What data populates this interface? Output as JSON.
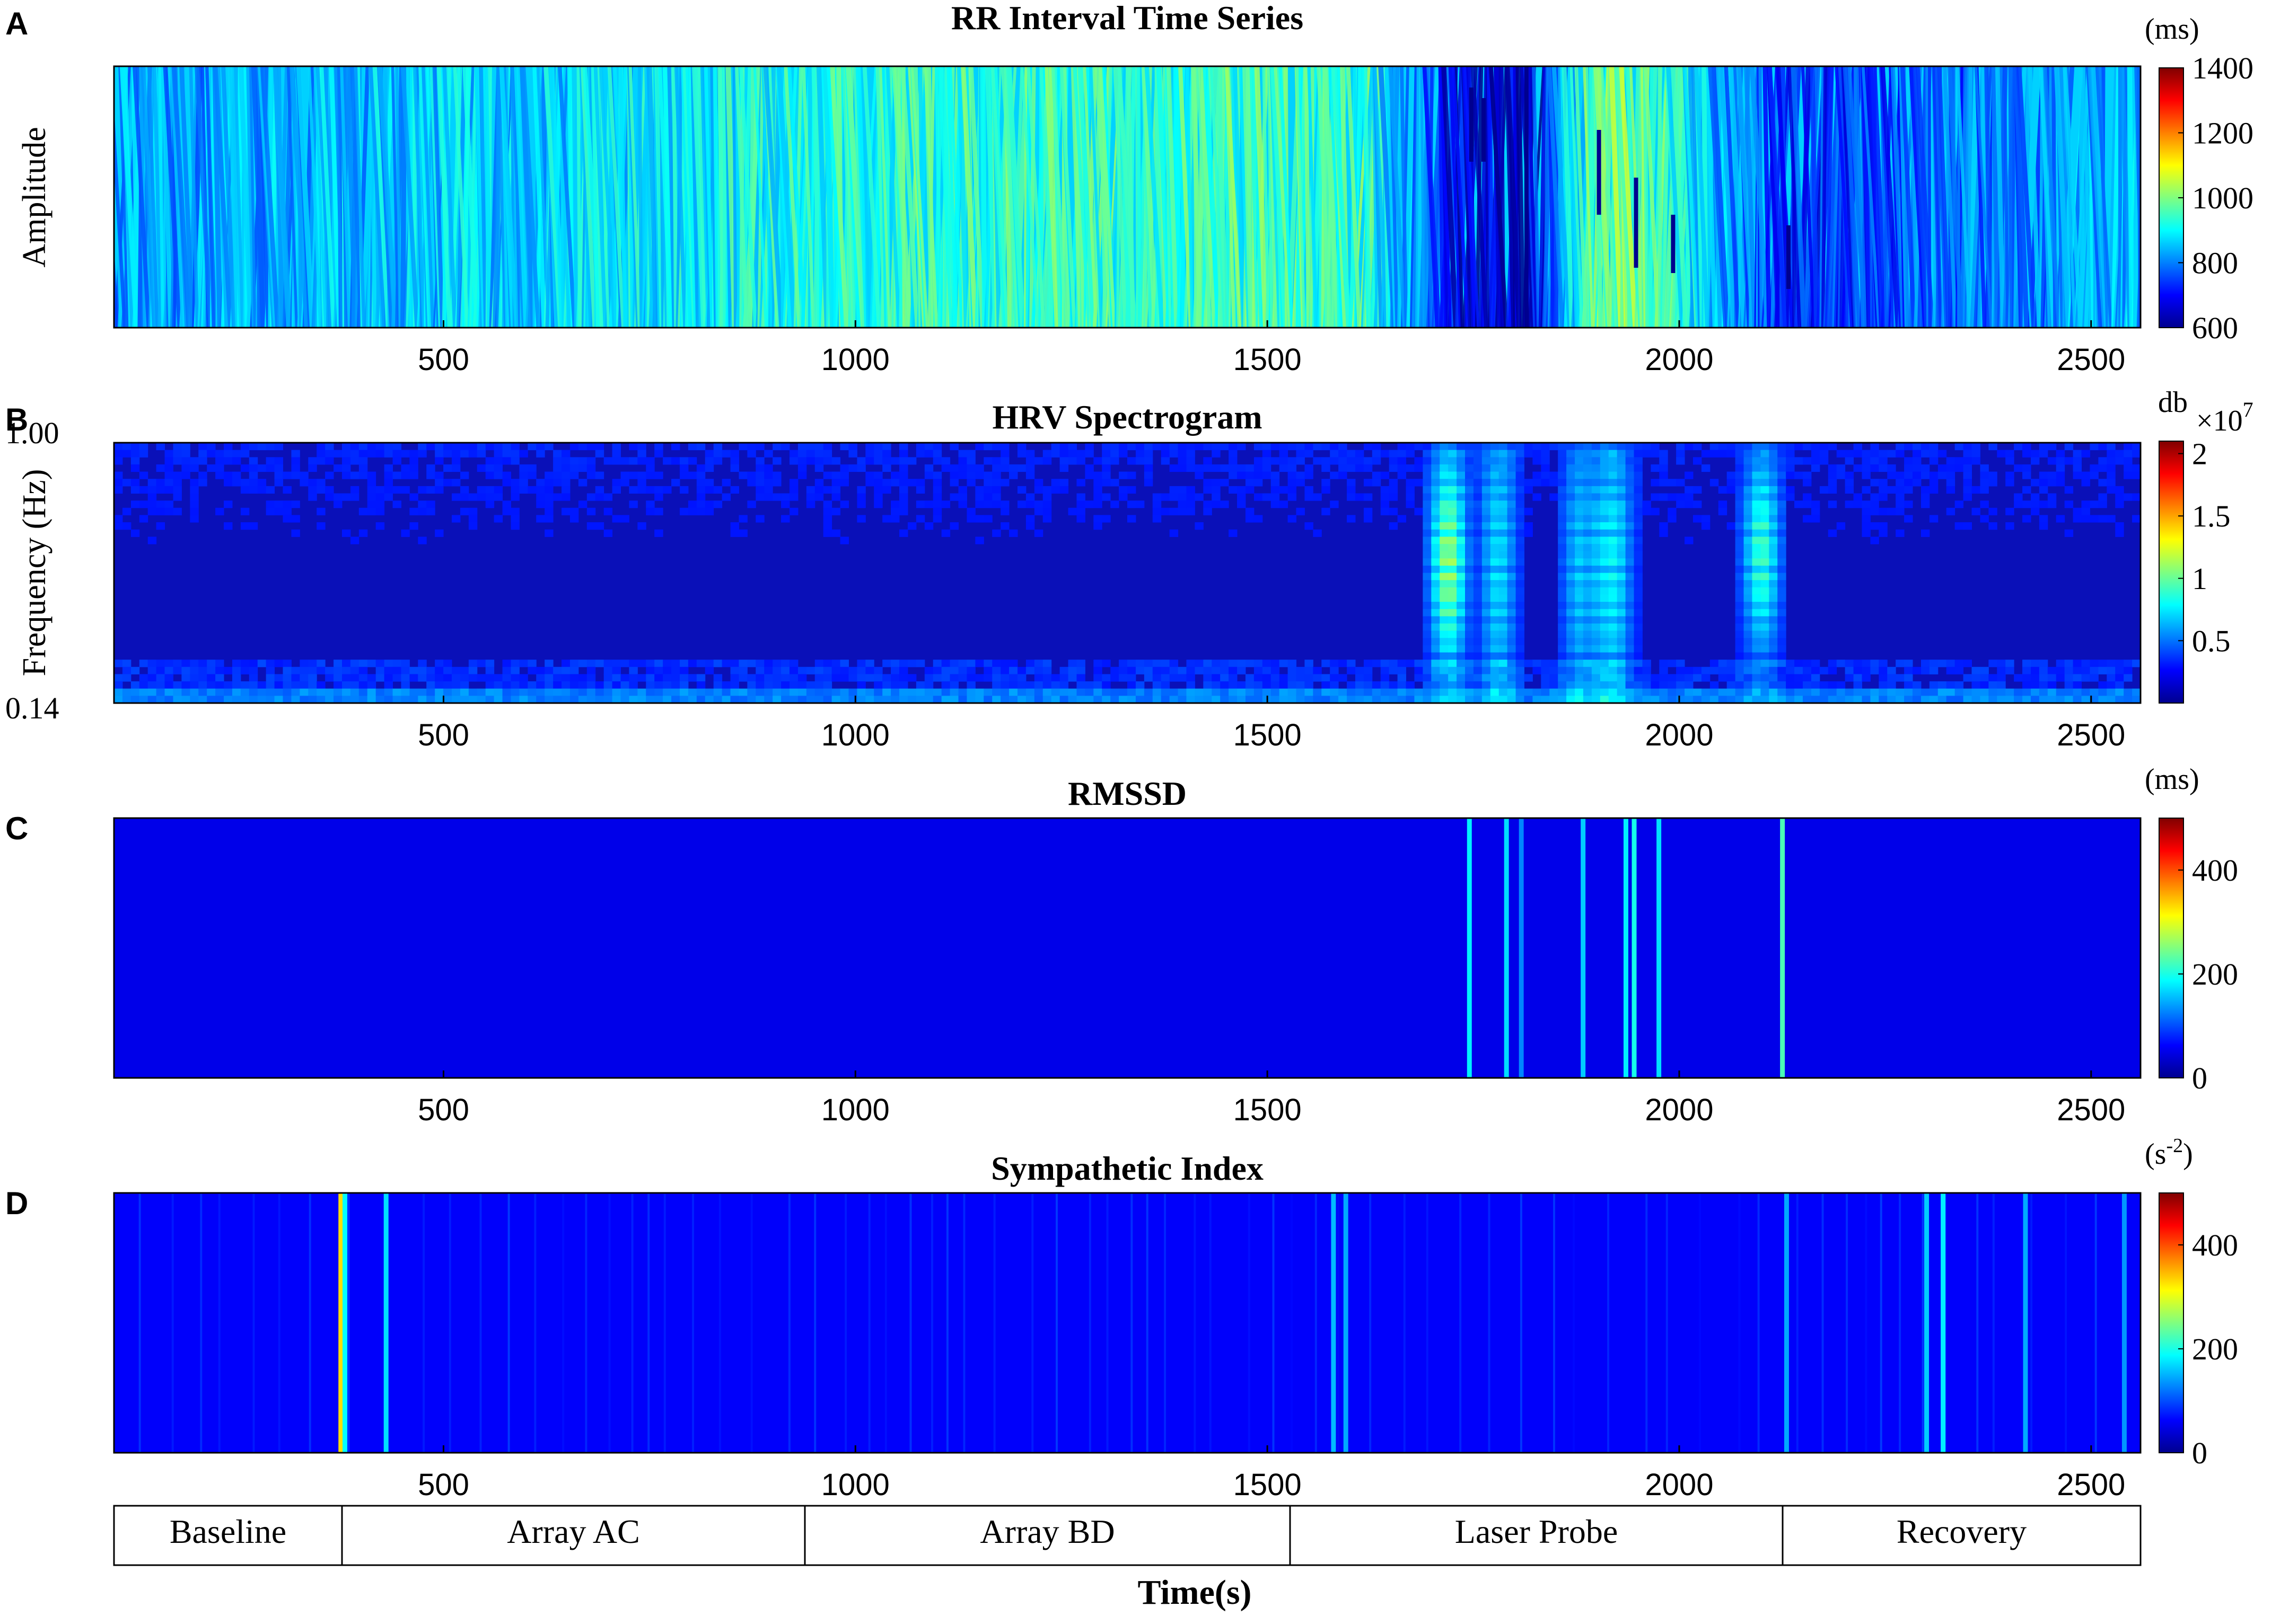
{
  "panels": [
    {
      "letter": "A",
      "title": "RR Interval Time Series",
      "ylabel": "Amplitude",
      "y_top": "",
      "y_bottom": "",
      "cbar_unit": "(ms)",
      "cbar_exp": "",
      "cbar_ticks": [
        "600",
        "800",
        "1000",
        "1200",
        "1400"
      ],
      "cbar_range": [
        600,
        1400
      ]
    },
    {
      "letter": "B",
      "title": "HRV Spectrogram",
      "ylabel": "Frequency (Hz)",
      "y_top": "1.00",
      "y_bottom": "0.14",
      "cbar_unit": "db",
      "cbar_exp": "×10",
      "cbar_exp_power": "7",
      "cbar_ticks": [
        "0.5",
        "1",
        "1.5",
        "2"
      ],
      "cbar_range": [
        0,
        2.1
      ]
    },
    {
      "letter": "C",
      "title": "RMSSD",
      "ylabel": "",
      "y_top": "",
      "y_bottom": "",
      "cbar_unit": "(ms)",
      "cbar_exp": "",
      "cbar_ticks": [
        "0",
        "200",
        "400"
      ],
      "cbar_range": [
        0,
        500
      ]
    },
    {
      "letter": "D",
      "title": "Sympathetic Index",
      "ylabel": "",
      "y_top": "",
      "y_bottom": "",
      "cbar_unit": "(s",
      "cbar_unit_sup": "-2",
      "cbar_unit_close": ")",
      "cbar_exp": "",
      "cbar_ticks": [
        "0",
        "200",
        "400"
      ],
      "cbar_range": [
        0,
        500
      ]
    }
  ],
  "x_ticks": [
    "500",
    "1000",
    "1500",
    "2000",
    "2500"
  ],
  "phases": [
    "Baseline",
    "Array AC",
    "Array BD",
    "Laser Probe",
    "Recovery"
  ],
  "xlabel": "Time(s)",
  "chart_data": [
    {
      "type": "heatmap",
      "title": "RR Interval Time Series",
      "ylabel": "Amplitude",
      "xlim": [
        100,
        2560
      ],
      "colorbar_label": "(ms)",
      "colorbar_range": [
        600,
        1400
      ],
      "colormap": "jet",
      "description_values": {
        "x": [
          100,
          370,
          670,
          1050,
          1610,
          1740,
          1810,
          1900,
          1950,
          2130,
          2560
        ],
        "rr_ms": [
          830,
          860,
          900,
          980,
          1000,
          620,
          600,
          1040,
          1060,
          700,
          860
        ]
      }
    },
    {
      "type": "heatmap",
      "title": "HRV Spectrogram",
      "ylabel": "Frequency (Hz)",
      "ylim": [
        0.14,
        1.0
      ],
      "xlim": [
        100,
        2560
      ],
      "colorbar_label": "db ×10^7",
      "colorbar_range": [
        0,
        2.1
      ],
      "colormap": "jet",
      "hotspots": [
        {
          "x": 1720,
          "f_range": [
            0.3,
            0.9
          ],
          "value": 0.9
        },
        {
          "x": 1780,
          "f_range": [
            0.14,
            1.0
          ],
          "value": 0.5
        },
        {
          "x": 1880,
          "f_range": [
            0.14,
            1.0
          ],
          "value": 0.45
        },
        {
          "x": 1920,
          "f_range": [
            0.14,
            1.0
          ],
          "value": 0.55
        },
        {
          "x": 2100,
          "f_range": [
            0.35,
            0.9
          ],
          "value": 0.7
        }
      ],
      "baseline_band": {
        "f": 0.16,
        "value": 0.4
      }
    },
    {
      "type": "heatmap",
      "title": "RMSSD",
      "xlim": [
        100,
        2560
      ],
      "colorbar_label": "(ms)",
      "colorbar_range": [
        0,
        500
      ],
      "colormap": "jet",
      "lines": [
        {
          "x": 1745,
          "value": 150
        },
        {
          "x": 1790,
          "value": 140
        },
        {
          "x": 1808,
          "value": 90
        },
        {
          "x": 1883,
          "value": 130
        },
        {
          "x": 1935,
          "value": 150
        },
        {
          "x": 1945,
          "value": 170
        },
        {
          "x": 1975,
          "value": 140
        },
        {
          "x": 2125,
          "value": 200
        }
      ],
      "background": 10
    },
    {
      "type": "heatmap",
      "title": "Sympathetic Index",
      "xlim": [
        100,
        2560
      ],
      "colorbar_label": "(s^-2)",
      "colorbar_range": [
        0,
        500
      ],
      "colormap": "jet",
      "lines": [
        {
          "x": 375,
          "value": 320
        },
        {
          "x": 380,
          "value": 160
        },
        {
          "x": 430,
          "value": 140
        },
        {
          "x": 1580,
          "value": 120
        },
        {
          "x": 1595,
          "value": 110
        },
        {
          "x": 2130,
          "value": 110
        },
        {
          "x": 2300,
          "value": 130
        },
        {
          "x": 2320,
          "value": 150
        },
        {
          "x": 2420,
          "value": 110
        },
        {
          "x": 2540,
          "value": 100
        }
      ],
      "background": 20
    }
  ]
}
